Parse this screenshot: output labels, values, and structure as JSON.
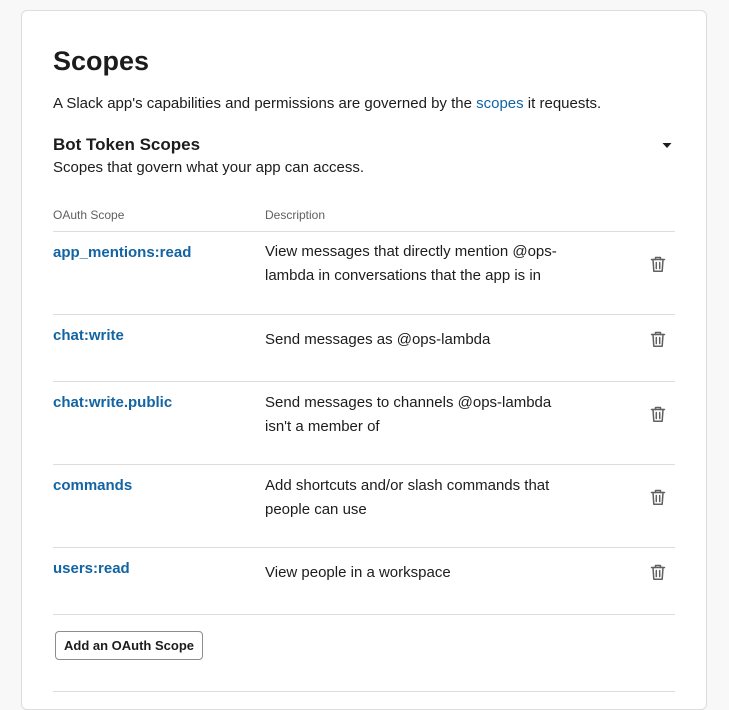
{
  "page": {
    "title": "Scopes",
    "intro": {
      "before": "A Slack app's capabilities and permissions are governed by the ",
      "link": "scopes",
      "after": " it requests."
    }
  },
  "bot_scopes": {
    "title": "Bot Token Scopes",
    "subtitle": "Scopes that govern what your app can access.",
    "collapse_icon": "caret-down-icon",
    "columns": {
      "scope": "OAuth Scope",
      "description": "Description"
    },
    "rows": [
      {
        "scope": "app_mentions:read",
        "description_lines": [
          "View messages that directly mention @ops-",
          "lambda in conversations that the app is in"
        ]
      },
      {
        "scope": "chat:write",
        "description_lines": [
          "Send messages as @ops-lambda"
        ]
      },
      {
        "scope": "chat:write.public",
        "description_lines": [
          "Send messages to channels @ops-lambda",
          "isn't a member of"
        ]
      },
      {
        "scope": "commands",
        "description_lines": [
          "Add shortcuts and/or slash commands that",
          "people can use"
        ]
      },
      {
        "scope": "users:read",
        "description_lines": [
          "View people in a workspace"
        ]
      }
    ],
    "row_action_icon": "trash-icon",
    "add_button_label": "Add an OAuth Scope"
  },
  "colors": {
    "link": "#1264a3",
    "text": "#1d1c1d",
    "muted": "#616061",
    "divider": "#dddddd"
  }
}
